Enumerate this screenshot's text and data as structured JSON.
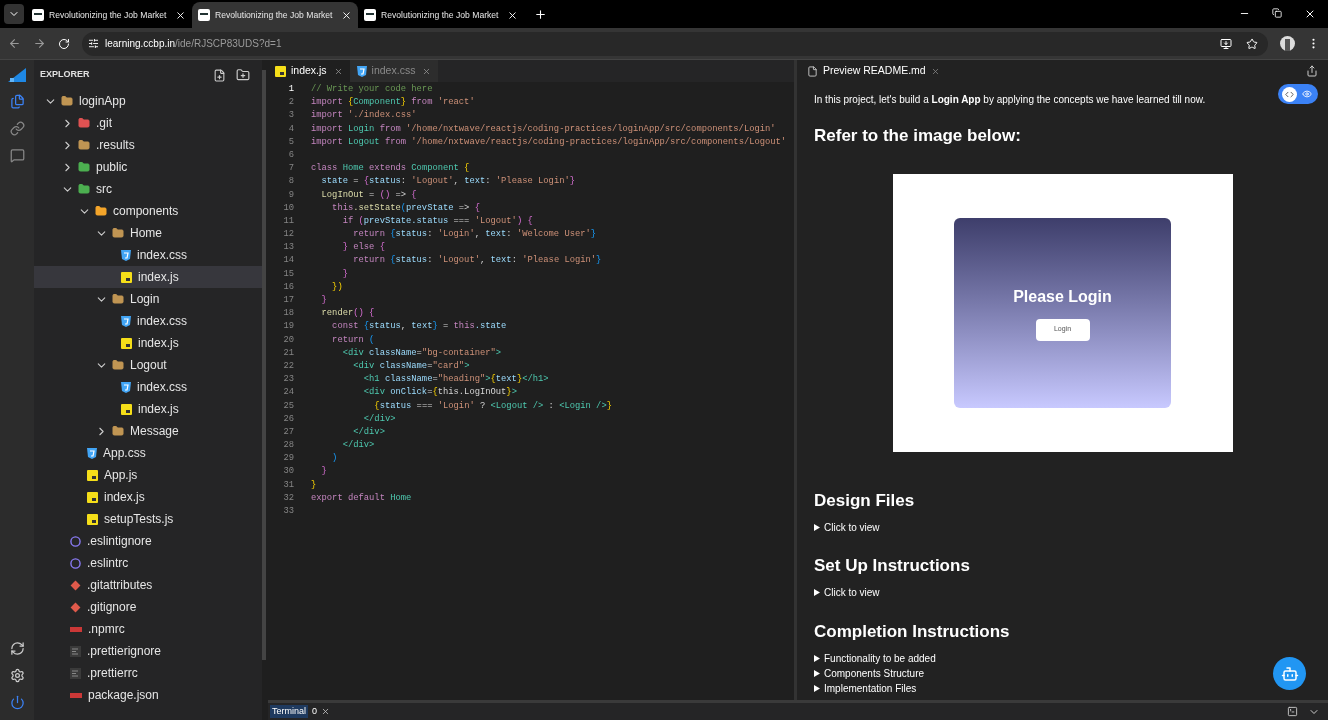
{
  "browser": {
    "tabs": [
      {
        "title": "Revolutionizing the Job Market",
        "selected": false
      },
      {
        "title": "Revolutionizing the Job Market",
        "selected": true
      },
      {
        "title": "Revolutionizing the Job Market",
        "selected": false
      }
    ],
    "url": {
      "host": "learning.ccbp.in",
      "path": "/ide/RJSCP83UDS?d=1"
    }
  },
  "activity_bar": {
    "items": [
      {
        "kind": "files",
        "selected": true
      },
      {
        "kind": "link",
        "selected": false
      },
      {
        "kind": "comment",
        "selected": false
      }
    ]
  },
  "explorer": {
    "title": "EXPLORER",
    "tree": [
      {
        "label": "loginApp",
        "kind": "folder",
        "expanded": true,
        "selected": false,
        "children": [
          {
            "label": ".git",
            "kind": "git-folder",
            "expanded": false,
            "selected": false
          },
          {
            "label": ".results",
            "kind": "folder",
            "expanded": false,
            "selected": false
          },
          {
            "label": "public",
            "kind": "green-folder",
            "expanded": false,
            "selected": false
          },
          {
            "label": "src",
            "kind": "green-folder",
            "expanded": true,
            "selected": false,
            "children": [
              {
                "label": "components",
                "kind": "orange-folder",
                "expanded": true,
                "selected": false,
                "children": [
                  {
                    "label": "Home",
                    "kind": "folder",
                    "expanded": true,
                    "selected": false,
                    "children": [
                      {
                        "label": "index.css",
                        "kind": "css",
                        "selected": false
                      },
                      {
                        "label": "index.js",
                        "kind": "js",
                        "selected": true
                      }
                    ]
                  },
                  {
                    "label": "Login",
                    "kind": "folder",
                    "expanded": true,
                    "selected": false,
                    "children": [
                      {
                        "label": "index.css",
                        "kind": "css",
                        "selected": false
                      },
                      {
                        "label": "index.js",
                        "kind": "js",
                        "selected": false
                      }
                    ]
                  },
                  {
                    "label": "Logout",
                    "kind": "folder",
                    "expanded": true,
                    "selected": false,
                    "children": [
                      {
                        "label": "index.css",
                        "kind": "css",
                        "selected": false
                      },
                      {
                        "label": "index.js",
                        "kind": "js",
                        "selected": false
                      }
                    ]
                  },
                  {
                    "label": "Message",
                    "kind": "folder",
                    "expanded": false,
                    "selected": false
                  }
                ]
              },
              {
                "label": "App.css",
                "kind": "css",
                "selected": false
              },
              {
                "label": "App.js",
                "kind": "js",
                "selected": false
              },
              {
                "label": "index.js",
                "kind": "js",
                "selected": false
              },
              {
                "label": "setupTests.js",
                "kind": "js",
                "selected": false
              }
            ]
          },
          {
            "label": ".eslintignore",
            "kind": "eslint",
            "selected": false
          },
          {
            "label": ".eslintrc",
            "kind": "eslint",
            "selected": false
          },
          {
            "label": ".gitattributes",
            "kind": "git",
            "selected": false
          },
          {
            "label": ".gitignore",
            "kind": "git",
            "selected": false
          },
          {
            "label": ".npmrc",
            "kind": "npm",
            "selected": false
          },
          {
            "label": ".prettierignore",
            "kind": "text",
            "selected": false
          },
          {
            "label": ".prettierrc",
            "kind": "text",
            "selected": false
          },
          {
            "label": "package.json",
            "kind": "npm",
            "selected": false
          }
        ]
      }
    ]
  },
  "editor": {
    "tabs": [
      {
        "label": "index.js",
        "kind": "js",
        "selected": true
      },
      {
        "label": "index.css",
        "kind": "css",
        "selected": false
      }
    ],
    "lines": [
      {
        "number": "1",
        "active": true,
        "tokens": [
          {
            "kind": "com",
            "text": "// Write your code here"
          }
        ]
      },
      {
        "number": "2",
        "active": false,
        "tokens": [
          {
            "kind": "kw",
            "text": "import "
          },
          {
            "kind": "br",
            "text": "{"
          },
          {
            "kind": "cls",
            "text": "Component"
          },
          {
            "kind": "br",
            "text": "}"
          },
          {
            "kind": "kw",
            "text": " from "
          },
          {
            "kind": "str",
            "text": "'react'"
          }
        ]
      },
      {
        "number": "3",
        "active": false,
        "tokens": [
          {
            "kind": "kw",
            "text": "import "
          },
          {
            "kind": "str",
            "text": "'./index.css'"
          }
        ]
      },
      {
        "number": "4",
        "active": false,
        "tokens": [
          {
            "kind": "kw",
            "text": "import "
          },
          {
            "kind": "cls",
            "text": "Login"
          },
          {
            "kind": "kw",
            "text": " from "
          },
          {
            "kind": "str",
            "text": "'/home/nxtwave/reactjs/coding-practices/loginApp/src/components/Login'"
          }
        ]
      },
      {
        "number": "5",
        "active": false,
        "tokens": [
          {
            "kind": "kw",
            "text": "import "
          },
          {
            "kind": "cls",
            "text": "Logout"
          },
          {
            "kind": "kw",
            "text": " from "
          },
          {
            "kind": "str",
            "text": "'/home/nxtwave/reactjs/coding-practices/loginApp/src/components/Logout'"
          }
        ]
      },
      {
        "number": "6",
        "active": false
      },
      {
        "number": "7",
        "active": false,
        "tokens": [
          {
            "kind": "kw",
            "text": "class "
          },
          {
            "kind": "cls",
            "text": "Home"
          },
          {
            "kind": "kw",
            "text": " extends "
          },
          {
            "kind": "cls",
            "text": "Component"
          },
          {
            "kind": "br",
            "text": " {"
          }
        ]
      },
      {
        "number": "8",
        "active": false,
        "tokens": [
          {
            "kind": "var",
            "text": "  state"
          },
          {
            "kind": "op",
            "text": " = "
          },
          {
            "kind": "br2",
            "text": "{"
          },
          {
            "kind": "var",
            "text": "status"
          },
          {
            "kind": "op",
            "text": ": "
          },
          {
            "kind": "str",
            "text": "'Logout'"
          },
          {
            "kind": "op",
            "text": ", "
          },
          {
            "kind": "var",
            "text": "text"
          },
          {
            "kind": "op",
            "text": ": "
          },
          {
            "kind": "str",
            "text": "'Please Login'"
          },
          {
            "kind": "br2",
            "text": "}"
          }
        ]
      },
      {
        "number": "9",
        "active": false,
        "tokens": [
          {
            "kind": "fn",
            "text": "  LogInOut"
          },
          {
            "kind": "op",
            "text": " = "
          },
          {
            "kind": "br2",
            "text": "()"
          },
          {
            "kind": "op",
            "text": " => "
          },
          {
            "kind": "br2",
            "text": "{"
          }
        ]
      },
      {
        "number": "10",
        "active": false,
        "tokens": [
          {
            "kind": "kw",
            "text": "    this"
          },
          {
            "kind": "fn",
            "text": ".setState"
          },
          {
            "kind": "br3",
            "text": "("
          },
          {
            "kind": "var",
            "text": "prevState"
          },
          {
            "kind": "op",
            "text": " => "
          },
          {
            "kind": "br2",
            "text": "{"
          }
        ]
      },
      {
        "number": "11",
        "active": false,
        "tokens": [
          {
            "kind": "kw",
            "text": "      if "
          },
          {
            "kind": "br2",
            "text": "("
          },
          {
            "kind": "var",
            "text": "prevState.status"
          },
          {
            "kind": "op",
            "text": " === "
          },
          {
            "kind": "str",
            "text": "'Logout'"
          },
          {
            "kind": "br2",
            "text": ") {"
          }
        ]
      },
      {
        "number": "12",
        "active": false,
        "tokens": [
          {
            "kind": "kw",
            "text": "        return "
          },
          {
            "kind": "br3",
            "text": "{"
          },
          {
            "kind": "var",
            "text": "status"
          },
          {
            "kind": "op",
            "text": ": "
          },
          {
            "kind": "str",
            "text": "'Login'"
          },
          {
            "kind": "op",
            "text": ", "
          },
          {
            "kind": "var",
            "text": "text"
          },
          {
            "kind": "op",
            "text": ": "
          },
          {
            "kind": "str",
            "text": "'Welcome User'"
          },
          {
            "kind": "br3",
            "text": "}"
          }
        ]
      },
      {
        "number": "13",
        "active": false,
        "tokens": [
          {
            "kind": "br2",
            "text": "      }"
          },
          {
            "kind": "kw",
            "text": " else "
          },
          {
            "kind": "br2",
            "text": "{"
          }
        ]
      },
      {
        "number": "14",
        "active": false,
        "tokens": [
          {
            "kind": "kw",
            "text": "        return "
          },
          {
            "kind": "br3",
            "text": "{"
          },
          {
            "kind": "var",
            "text": "status"
          },
          {
            "kind": "op",
            "text": ": "
          },
          {
            "kind": "str",
            "text": "'Logout'"
          },
          {
            "kind": "op",
            "text": ", "
          },
          {
            "kind": "var",
            "text": "text"
          },
          {
            "kind": "op",
            "text": ": "
          },
          {
            "kind": "str",
            "text": "'Please Login'"
          },
          {
            "kind": "br3",
            "text": "}"
          }
        ]
      },
      {
        "number": "15",
        "active": false,
        "tokens": [
          {
            "kind": "br2",
            "text": "      }"
          }
        ]
      },
      {
        "number": "16",
        "active": false,
        "tokens": [
          {
            "kind": "br",
            "text": "    })"
          }
        ]
      },
      {
        "number": "17",
        "active": false,
        "tokens": [
          {
            "kind": "br2",
            "text": "  }"
          }
        ]
      },
      {
        "number": "18",
        "active": false,
        "tokens": [
          {
            "kind": "fn",
            "text": "  render"
          },
          {
            "kind": "br2",
            "text": "() {"
          }
        ]
      },
      {
        "number": "19",
        "active": false,
        "tokens": [
          {
            "kind": "kw",
            "text": "    const "
          },
          {
            "kind": "br3",
            "text": "{"
          },
          {
            "kind": "var",
            "text": "status"
          },
          {
            "kind": "op",
            "text": ", "
          },
          {
            "kind": "var",
            "text": "text"
          },
          {
            "kind": "br3",
            "text": "}"
          },
          {
            "kind": "op",
            "text": " = "
          },
          {
            "kind": "kw",
            "text": "this"
          },
          {
            "kind": "var",
            "text": ".state"
          }
        ]
      },
      {
        "number": "20",
        "active": false,
        "tokens": [
          {
            "kind": "kw",
            "text": "    return "
          },
          {
            "kind": "br3",
            "text": "("
          }
        ]
      },
      {
        "number": "21",
        "active": false,
        "tokens": [
          {
            "kind": "tag",
            "text": "      <div "
          },
          {
            "kind": "var",
            "text": "className"
          },
          {
            "kind": "op",
            "text": "="
          },
          {
            "kind": "str",
            "text": "\"bg-container\""
          },
          {
            "kind": "tag",
            "text": ">"
          }
        ]
      },
      {
        "number": "22",
        "active": false,
        "tokens": [
          {
            "kind": "tag",
            "text": "        <div "
          },
          {
            "kind": "var",
            "text": "className"
          },
          {
            "kind": "op",
            "text": "="
          },
          {
            "kind": "str",
            "text": "\"card\""
          },
          {
            "kind": "tag",
            "text": ">"
          }
        ]
      },
      {
        "number": "23",
        "active": false,
        "tokens": [
          {
            "kind": "tag",
            "text": "          <h1 "
          },
          {
            "kind": "var",
            "text": "className"
          },
          {
            "kind": "op",
            "text": "="
          },
          {
            "kind": "str",
            "text": "\"heading\""
          },
          {
            "kind": "tag",
            "text": ">"
          },
          {
            "kind": "br",
            "text": "{"
          },
          {
            "kind": "var",
            "text": "text"
          },
          {
            "kind": "br",
            "text": "}"
          },
          {
            "kind": "tag",
            "text": "</h1>"
          }
        ]
      },
      {
        "number": "24",
        "active": false,
        "tokens": [
          {
            "kind": "tag",
            "text": "          <div "
          },
          {
            "kind": "var",
            "text": "onClick"
          },
          {
            "kind": "op",
            "text": "="
          },
          {
            "kind": "br",
            "text": "{"
          },
          {
            "kind": "op",
            "text": "this.LogInOut"
          },
          {
            "kind": "br",
            "text": "}"
          },
          {
            "kind": "tag",
            "text": ">"
          }
        ]
      },
      {
        "number": "25",
        "active": false,
        "tokens": [
          {
            "kind": "br",
            "text": "            {"
          },
          {
            "kind": "var",
            "text": "status"
          },
          {
            "kind": "op",
            "text": " === "
          },
          {
            "kind": "str",
            "text": "'Login'"
          },
          {
            "kind": "op",
            "text": " ? "
          },
          {
            "kind": "tag",
            "text": "<Logout />"
          },
          {
            "kind": "op",
            "text": " : "
          },
          {
            "kind": "tag",
            "text": "<Login />"
          },
          {
            "kind": "br",
            "text": "}"
          }
        ]
      },
      {
        "number": "26",
        "active": false,
        "tokens": [
          {
            "kind": "tag",
            "text": "          </div>"
          }
        ]
      },
      {
        "number": "27",
        "active": false,
        "tokens": [
          {
            "kind": "tag",
            "text": "        </div>"
          }
        ]
      },
      {
        "number": "28",
        "active": false,
        "tokens": [
          {
            "kind": "tag",
            "text": "      </div>"
          }
        ]
      },
      {
        "number": "29",
        "active": false,
        "tokens": [
          {
            "kind": "br3",
            "text": "    )"
          }
        ]
      },
      {
        "number": "30",
        "active": false,
        "tokens": [
          {
            "kind": "br2",
            "text": "  }"
          }
        ]
      },
      {
        "number": "31",
        "active": false,
        "tokens": [
          {
            "kind": "br",
            "text": "}"
          }
        ]
      },
      {
        "number": "32",
        "active": false,
        "tokens": [
          {
            "kind": "kw",
            "text": "export default "
          },
          {
            "kind": "cls",
            "text": "Home"
          }
        ]
      },
      {
        "number": "33",
        "active": false
      }
    ]
  },
  "preview": {
    "tab": "Preview README.md",
    "view_toggle": [
      {
        "kind": "code",
        "selected": true
      },
      {
        "kind": "preview",
        "selected": false
      }
    ],
    "intro": "In this project, let's build a **Login App** by applying the concepts we have learned till now.",
    "sections": [
      {
        "heading": "Refer to the image below:",
        "kind": "image",
        "app": {
          "heading": "Please Login",
          "button": "Login"
        }
      },
      {
        "heading": "Design Files",
        "kind": "details",
        "items": [
          "Click to view"
        ]
      },
      {
        "heading": "Set Up Instructions",
        "kind": "details",
        "items": [
          "Click to view"
        ]
      },
      {
        "heading": "Completion Instructions",
        "kind": "details",
        "items": [
          "Functionality to be added",
          "Components Structure",
          "Implementation Files"
        ]
      }
    ]
  },
  "terminal": {
    "tab": "Terminal",
    "count": "0"
  }
}
